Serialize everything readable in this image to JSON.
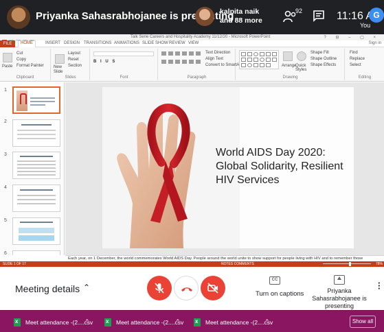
{
  "meet": {
    "presenter_title": "Priyanka Sahasrabhojanee is presenting",
    "peer_name": "kalpita naik",
    "peer_more": "and 88 more",
    "people_count": "92",
    "time": "11:16 AM",
    "user_initial": "G",
    "you_label": "You"
  },
  "ppt": {
    "doc_title": "Talk Serie Careers and Hospitality Academy 11/12/20 - Microsoft PowerPoint",
    "window_controls": "? ⊟ – ▢ ×",
    "signin": "Sign in",
    "tabs": [
      "FILE",
      "HOME",
      "INSERT",
      "DESIGN",
      "TRANSITIONS",
      "ANIMATIONS",
      "SLIDE SHOW",
      "REVIEW",
      "VIEW"
    ],
    "ribbon": {
      "cut": "Cut",
      "copy": "Copy",
      "format_painter": "Format Painter",
      "paste": "Paste",
      "new_slide": "New Slide",
      "layout": "Layout",
      "reset": "Reset",
      "section": "Section",
      "text_direction": "Text Direction",
      "align_text": "Align Text",
      "convert_smartart": "Convert to SmartArt",
      "arrange": "Arrange",
      "quick_styles": "Quick Styles",
      "shape_fill": "Shape Fill",
      "shape_outline": "Shape Outline",
      "shape_effects": "Shape Effects",
      "find": "Find",
      "replace": "Replace",
      "select": "Select",
      "groups": [
        "Clipboard",
        "Slides",
        "Font",
        "Paragraph",
        "Drawing",
        "Editing"
      ]
    },
    "thumb_numbers": [
      "1",
      "2",
      "3",
      "4",
      "5",
      "6"
    ],
    "slide_title_lines": [
      "World AIDS Day 2020:",
      "Global Solidarity, Resilient",
      "HIV Services"
    ],
    "notes": "Each year, on 1 December, the world commemorates World AIDS Day. People around the world unite to show support for people living with HIV and to remember those",
    "status_left": "SLIDE 1 OF 17",
    "status_right": "NOTES    COMMENTS",
    "zoom": "78%"
  },
  "controls": {
    "meeting_details": "Meeting details",
    "captions_label": "Turn on captions",
    "presenting_label": "Priyanka Sahasrabhojanee is presenting",
    "cc_glyph": "CC"
  },
  "downloads": {
    "items": [
      "Meet attendance -(2....csv",
      "Meet attendance -(2....csv",
      "Meet attendance -(2....csv"
    ],
    "show_all": "Show all"
  }
}
